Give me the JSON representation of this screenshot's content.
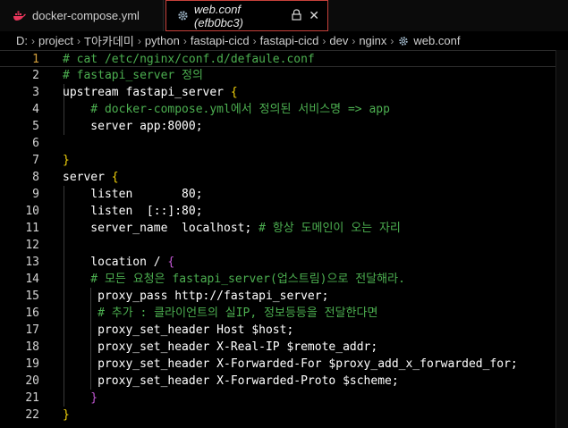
{
  "tabs": [
    {
      "label": "docker-compose.yml",
      "icon": "docker-whale-icon"
    },
    {
      "label": "web.conf (efb0bc3)",
      "icon": "gear-icon",
      "close": "✕"
    }
  ],
  "breadcrumb": [
    "D:",
    "project",
    "T아카데미",
    "python",
    "fastapi-cicd",
    "fastapi-cicd",
    "dev",
    "nginx",
    "web.conf"
  ],
  "editor": {
    "line_numbers": [
      "1",
      "2",
      "3",
      "4",
      "5",
      "6",
      "7",
      "8",
      "9",
      "10",
      "11",
      "12",
      "13",
      "14",
      "15",
      "16",
      "17",
      "18",
      "19",
      "20",
      "21",
      "22"
    ],
    "lines": [
      "# cat /etc/nginx/conf.d/defaule.conf",
      "# fastapi_server 정의",
      "upstream fastapi_server {",
      "    # docker-compose.yml에서 정의된 서비스명 => app",
      "    server app:8000;",
      "",
      "}",
      "server {",
      "    listen       80;",
      "    listen  [::]:80;",
      "    server_name  localhost; # 항상 도메인이 오는 자리",
      "",
      "    location / {",
      "    # 모든 요청은 fastapi_server(업스트림)으로 전달해라.",
      "     proxy_pass http://fastapi_server;",
      "     # 추가 : 클라이언트의 실IP, 정보등등을 전달한다면",
      "     proxy_set_header Host $host;",
      "     proxy_set_header X-Real-IP $remote_addr;",
      "     proxy_set_header X-Forwarded-For $proxy_add_x_forwarded_for;",
      "     proxy_set_header X-Forwarded-Proto $scheme;",
      "    }",
      "}"
    ]
  },
  "colors": {
    "comment": "#4caf50",
    "bracket_outer": "#f2d20a",
    "bracket_inner": "#c458d6",
    "active_line_number": "#d4a03c",
    "active_tab_border": "#c7413a"
  }
}
